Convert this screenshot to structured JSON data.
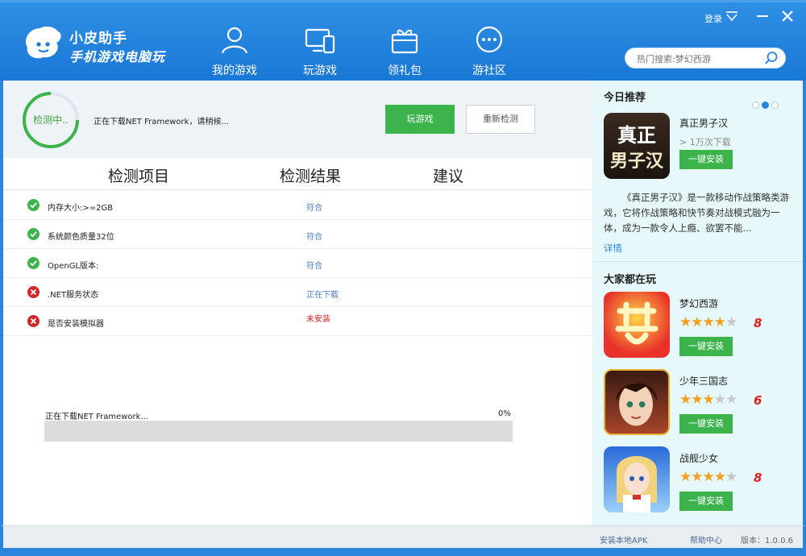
{
  "app": {
    "title": "小皮助手",
    "subtitle": "手机游戏电脑玩",
    "login": "登录"
  },
  "nav": [
    {
      "label": "我的游戏",
      "icon": "user-icon"
    },
    {
      "label": "玩游戏",
      "icon": "devices-icon"
    },
    {
      "label": "领礼包",
      "icon": "gift-icon"
    },
    {
      "label": "游社区",
      "icon": "chat-icon"
    }
  ],
  "search": {
    "placeholder": "热门搜索:梦幻西游"
  },
  "status": {
    "ring_label": "检测中..",
    "message": "正在下载NET Framework，请稍候...",
    "play_label": "玩游戏",
    "recheck_label": "重新检测"
  },
  "table": {
    "headers": [
      "检测项目",
      "检测结果",
      "建议"
    ],
    "rows": [
      {
        "label": "内存大小:>=2GB",
        "result": "符合",
        "ok": true
      },
      {
        "label": "系统颜色质量32位",
        "result": "符合",
        "ok": true
      },
      {
        "label": "OpenGL版本:",
        "result": "符合",
        "ok": true
      },
      {
        "label": ".NET服务状态",
        "result": "正在下载",
        "ok": false
      },
      {
        "label": "是否安装模拟器",
        "result": "未安装",
        "ok": false
      }
    ]
  },
  "download": {
    "label": "正在下载NET Framework...",
    "percent_text": "0%",
    "progress": 0
  },
  "sidebar": {
    "today_title": "今日推荐",
    "featured": {
      "name": "真正男子汉",
      "downloads": "> 1万次下载",
      "install": "一键安装",
      "icon_text_1": "真正",
      "icon_text_2": "男子汉",
      "description": "《真正男子汉》是一款移动作战策略类游戏，它将作战策略和快节奏对战模式融为一体，成为一款令人上瘾、欲罢不能...",
      "more": "详情"
    },
    "popular_title": "大家都在玩",
    "games": [
      {
        "name": "梦幻西游",
        "rating": 4,
        "score": "8",
        "install": "一键安装",
        "icon": "menghuan-icon"
      },
      {
        "name": "少年三国志",
        "rating": 3,
        "score": "6",
        "install": "一键安装",
        "icon": "sanguo-icon"
      },
      {
        "name": "战舰少女",
        "rating": 4,
        "score": "8",
        "install": "一键安装",
        "icon": "zhanjian-icon"
      }
    ]
  },
  "footer": {
    "install_apk": "安装本地APK",
    "help": "帮助中心",
    "version": "版本：1.0.0.6"
  },
  "colors": {
    "accent": "#2a86dc",
    "green": "#3cb44b",
    "red": "#d02020",
    "sidebar_bg": "#e7f8fb"
  }
}
